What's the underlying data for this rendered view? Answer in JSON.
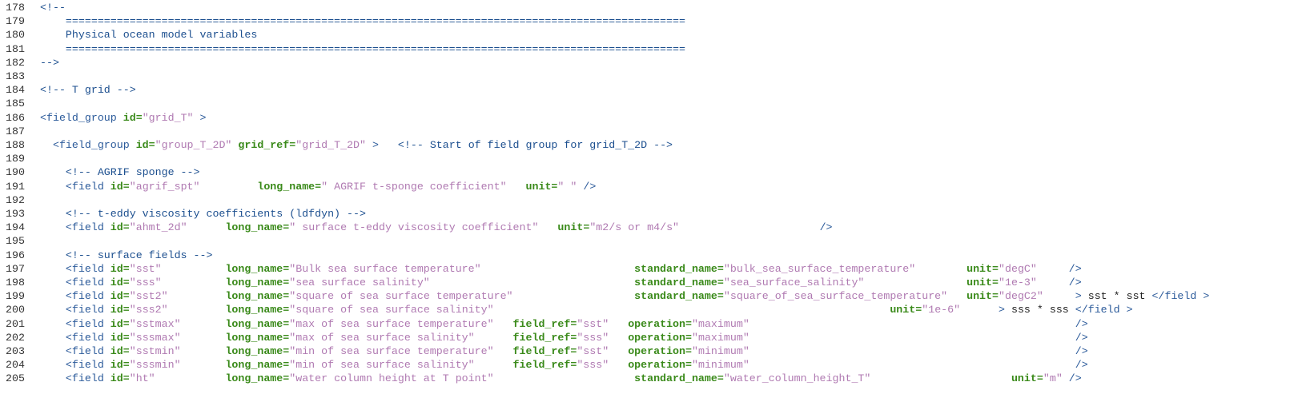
{
  "editor": {
    "theme_colors": {
      "comment": "#1c4f8f",
      "tag": "#2b5a9a",
      "attribute": "#3a8a1a",
      "string": "#b07ab2",
      "text": "#222222",
      "line_number": "#333333",
      "background": "#ffffff"
    },
    "lines": [
      {
        "num": "178",
        "tokens": [
          {
            "t": "comment",
            "v": "<!--"
          }
        ]
      },
      {
        "num": "179",
        "tokens": [
          {
            "t": "comment",
            "v": "    ================================================================================================="
          }
        ]
      },
      {
        "num": "180",
        "tokens": [
          {
            "t": "comment",
            "v": "    Physical ocean model variables"
          }
        ]
      },
      {
        "num": "181",
        "tokens": [
          {
            "t": "comment",
            "v": "    ================================================================================================="
          }
        ]
      },
      {
        "num": "182",
        "tokens": [
          {
            "t": "comment",
            "v": "-->"
          }
        ]
      },
      {
        "num": "183",
        "tokens": []
      },
      {
        "num": "184",
        "tokens": [
          {
            "t": "comment",
            "v": "<!-- T grid -->"
          }
        ]
      },
      {
        "num": "185",
        "tokens": []
      },
      {
        "num": "186",
        "tokens": [
          {
            "t": "tag",
            "v": "<field_group "
          },
          {
            "t": "attr",
            "v": "id="
          },
          {
            "t": "str",
            "v": "\"grid_T\""
          },
          {
            "t": "tag",
            "v": " >"
          }
        ]
      },
      {
        "num": "187",
        "tokens": []
      },
      {
        "num": "188",
        "tokens": [
          {
            "t": "tag",
            "v": "  <field_group "
          },
          {
            "t": "attr",
            "v": "id="
          },
          {
            "t": "str",
            "v": "\"group_T_2D\""
          },
          {
            "t": "tag",
            "v": " "
          },
          {
            "t": "attr",
            "v": "grid_ref="
          },
          {
            "t": "str",
            "v": "\"grid_T_2D\""
          },
          {
            "t": "tag",
            "v": " >   "
          },
          {
            "t": "comment",
            "v": "<!-- Start of field group for grid_T_2D -->"
          }
        ]
      },
      {
        "num": "189",
        "tokens": []
      },
      {
        "num": "190",
        "tokens": [
          {
            "t": "comment",
            "v": "    <!-- AGRIF sponge -->"
          }
        ]
      },
      {
        "num": "191",
        "tokens": [
          {
            "t": "tag",
            "v": "    <field "
          },
          {
            "t": "attr",
            "v": "id="
          },
          {
            "t": "str",
            "v": "\"agrif_spt\""
          },
          {
            "t": "tag",
            "v": "         "
          },
          {
            "t": "attr",
            "v": "long_name="
          },
          {
            "t": "str",
            "v": "\" AGRIF t-sponge coefficient\""
          },
          {
            "t": "tag",
            "v": "   "
          },
          {
            "t": "attr",
            "v": "unit="
          },
          {
            "t": "str",
            "v": "\" \""
          },
          {
            "t": "tag",
            "v": " />"
          }
        ]
      },
      {
        "num": "192",
        "tokens": []
      },
      {
        "num": "193",
        "tokens": [
          {
            "t": "comment",
            "v": "    <!-- t-eddy viscosity coefficients (ldfdyn) -->"
          }
        ]
      },
      {
        "num": "194",
        "tokens": [
          {
            "t": "tag",
            "v": "    <field "
          },
          {
            "t": "attr",
            "v": "id="
          },
          {
            "t": "str",
            "v": "\"ahmt_2d\""
          },
          {
            "t": "tag",
            "v": "      "
          },
          {
            "t": "attr",
            "v": "long_name="
          },
          {
            "t": "str",
            "v": "\" surface t-eddy viscosity coefficient\""
          },
          {
            "t": "tag",
            "v": "   "
          },
          {
            "t": "attr",
            "v": "unit="
          },
          {
            "t": "str",
            "v": "\"m2/s or m4/s\""
          },
          {
            "t": "tag",
            "v": "                      />"
          }
        ]
      },
      {
        "num": "195",
        "tokens": []
      },
      {
        "num": "196",
        "tokens": [
          {
            "t": "comment",
            "v": "    <!-- surface fields -->"
          }
        ]
      },
      {
        "num": "197",
        "tokens": [
          {
            "t": "tag",
            "v": "    <field "
          },
          {
            "t": "attr",
            "v": "id="
          },
          {
            "t": "str",
            "v": "\"sst\""
          },
          {
            "t": "tag",
            "v": "          "
          },
          {
            "t": "attr",
            "v": "long_name="
          },
          {
            "t": "str",
            "v": "\"Bulk sea surface temperature\""
          },
          {
            "t": "tag",
            "v": "                        "
          },
          {
            "t": "attr",
            "v": "standard_name="
          },
          {
            "t": "str",
            "v": "\"bulk_sea_surface_temperature\""
          },
          {
            "t": "tag",
            "v": "        "
          },
          {
            "t": "attr",
            "v": "unit="
          },
          {
            "t": "str",
            "v": "\"degC\""
          },
          {
            "t": "tag",
            "v": "     />"
          }
        ]
      },
      {
        "num": "198",
        "tokens": [
          {
            "t": "tag",
            "v": "    <field "
          },
          {
            "t": "attr",
            "v": "id="
          },
          {
            "t": "str",
            "v": "\"sss\""
          },
          {
            "t": "tag",
            "v": "          "
          },
          {
            "t": "attr",
            "v": "long_name="
          },
          {
            "t": "str",
            "v": "\"sea surface salinity\""
          },
          {
            "t": "tag",
            "v": "                                "
          },
          {
            "t": "attr",
            "v": "standard_name="
          },
          {
            "t": "str",
            "v": "\"sea_surface_salinity\""
          },
          {
            "t": "tag",
            "v": "                "
          },
          {
            "t": "attr",
            "v": "unit="
          },
          {
            "t": "str",
            "v": "\"1e-3\""
          },
          {
            "t": "tag",
            "v": "     />"
          }
        ]
      },
      {
        "num": "199",
        "tokens": [
          {
            "t": "tag",
            "v": "    <field "
          },
          {
            "t": "attr",
            "v": "id="
          },
          {
            "t": "str",
            "v": "\"sst2\""
          },
          {
            "t": "tag",
            "v": "         "
          },
          {
            "t": "attr",
            "v": "long_name="
          },
          {
            "t": "str",
            "v": "\"square of sea surface temperature\""
          },
          {
            "t": "tag",
            "v": "                   "
          },
          {
            "t": "attr",
            "v": "standard_name="
          },
          {
            "t": "str",
            "v": "\"square_of_sea_surface_temperature\""
          },
          {
            "t": "tag",
            "v": "   "
          },
          {
            "t": "attr",
            "v": "unit="
          },
          {
            "t": "str",
            "v": "\"degC2\""
          },
          {
            "t": "tag",
            "v": "     > "
          },
          {
            "t": "text",
            "v": "sst * sst "
          },
          {
            "t": "tag",
            "v": "</field >"
          }
        ]
      },
      {
        "num": "200",
        "tokens": [
          {
            "t": "tag",
            "v": "    <field "
          },
          {
            "t": "attr",
            "v": "id="
          },
          {
            "t": "str",
            "v": "\"sss2\""
          },
          {
            "t": "tag",
            "v": "         "
          },
          {
            "t": "attr",
            "v": "long_name="
          },
          {
            "t": "str",
            "v": "\"square of sea surface salinity\""
          },
          {
            "t": "tag",
            "v": "                                                              "
          },
          {
            "t": "attr",
            "v": "unit="
          },
          {
            "t": "str",
            "v": "\"1e-6\""
          },
          {
            "t": "tag",
            "v": "      > "
          },
          {
            "t": "text",
            "v": "sss * sss "
          },
          {
            "t": "tag",
            "v": "</field >"
          }
        ]
      },
      {
        "num": "201",
        "tokens": [
          {
            "t": "tag",
            "v": "    <field "
          },
          {
            "t": "attr",
            "v": "id="
          },
          {
            "t": "str",
            "v": "\"sstmax\""
          },
          {
            "t": "tag",
            "v": "       "
          },
          {
            "t": "attr",
            "v": "long_name="
          },
          {
            "t": "str",
            "v": "\"max of sea surface temperature\""
          },
          {
            "t": "tag",
            "v": "   "
          },
          {
            "t": "attr",
            "v": "field_ref="
          },
          {
            "t": "str",
            "v": "\"sst\""
          },
          {
            "t": "tag",
            "v": "   "
          },
          {
            "t": "attr",
            "v": "operation="
          },
          {
            "t": "str",
            "v": "\"maximum\""
          },
          {
            "t": "tag",
            "v": "                                                   />"
          }
        ]
      },
      {
        "num": "202",
        "tokens": [
          {
            "t": "tag",
            "v": "    <field "
          },
          {
            "t": "attr",
            "v": "id="
          },
          {
            "t": "str",
            "v": "\"sssmax\""
          },
          {
            "t": "tag",
            "v": "       "
          },
          {
            "t": "attr",
            "v": "long_name="
          },
          {
            "t": "str",
            "v": "\"max of sea surface salinity\""
          },
          {
            "t": "tag",
            "v": "      "
          },
          {
            "t": "attr",
            "v": "field_ref="
          },
          {
            "t": "str",
            "v": "\"sss\""
          },
          {
            "t": "tag",
            "v": "   "
          },
          {
            "t": "attr",
            "v": "operation="
          },
          {
            "t": "str",
            "v": "\"maximum\""
          },
          {
            "t": "tag",
            "v": "                                                   />"
          }
        ]
      },
      {
        "num": "203",
        "tokens": [
          {
            "t": "tag",
            "v": "    <field "
          },
          {
            "t": "attr",
            "v": "id="
          },
          {
            "t": "str",
            "v": "\"sstmin\""
          },
          {
            "t": "tag",
            "v": "       "
          },
          {
            "t": "attr",
            "v": "long_name="
          },
          {
            "t": "str",
            "v": "\"min of sea surface temperature\""
          },
          {
            "t": "tag",
            "v": "   "
          },
          {
            "t": "attr",
            "v": "field_ref="
          },
          {
            "t": "str",
            "v": "\"sst\""
          },
          {
            "t": "tag",
            "v": "   "
          },
          {
            "t": "attr",
            "v": "operation="
          },
          {
            "t": "str",
            "v": "\"minimum\""
          },
          {
            "t": "tag",
            "v": "                                                   />"
          }
        ]
      },
      {
        "num": "204",
        "tokens": [
          {
            "t": "tag",
            "v": "    <field "
          },
          {
            "t": "attr",
            "v": "id="
          },
          {
            "t": "str",
            "v": "\"sssmin\""
          },
          {
            "t": "tag",
            "v": "       "
          },
          {
            "t": "attr",
            "v": "long_name="
          },
          {
            "t": "str",
            "v": "\"min of sea surface salinity\""
          },
          {
            "t": "tag",
            "v": "      "
          },
          {
            "t": "attr",
            "v": "field_ref="
          },
          {
            "t": "str",
            "v": "\"sss\""
          },
          {
            "t": "tag",
            "v": "   "
          },
          {
            "t": "attr",
            "v": "operation="
          },
          {
            "t": "str",
            "v": "\"minimum\""
          },
          {
            "t": "tag",
            "v": "                                                   />"
          }
        ]
      },
      {
        "num": "205",
        "tokens": [
          {
            "t": "tag",
            "v": "    <field "
          },
          {
            "t": "attr",
            "v": "id="
          },
          {
            "t": "str",
            "v": "\"ht\""
          },
          {
            "t": "tag",
            "v": "           "
          },
          {
            "t": "attr",
            "v": "long_name="
          },
          {
            "t": "str",
            "v": "\"water column height at T point\""
          },
          {
            "t": "tag",
            "v": "                      "
          },
          {
            "t": "attr",
            "v": "standard_name="
          },
          {
            "t": "str",
            "v": "\"water_column_height_T\""
          },
          {
            "t": "tag",
            "v": "                      "
          },
          {
            "t": "attr",
            "v": "unit="
          },
          {
            "t": "str",
            "v": "\"m\""
          },
          {
            "t": "tag",
            "v": " />"
          }
        ]
      }
    ]
  }
}
